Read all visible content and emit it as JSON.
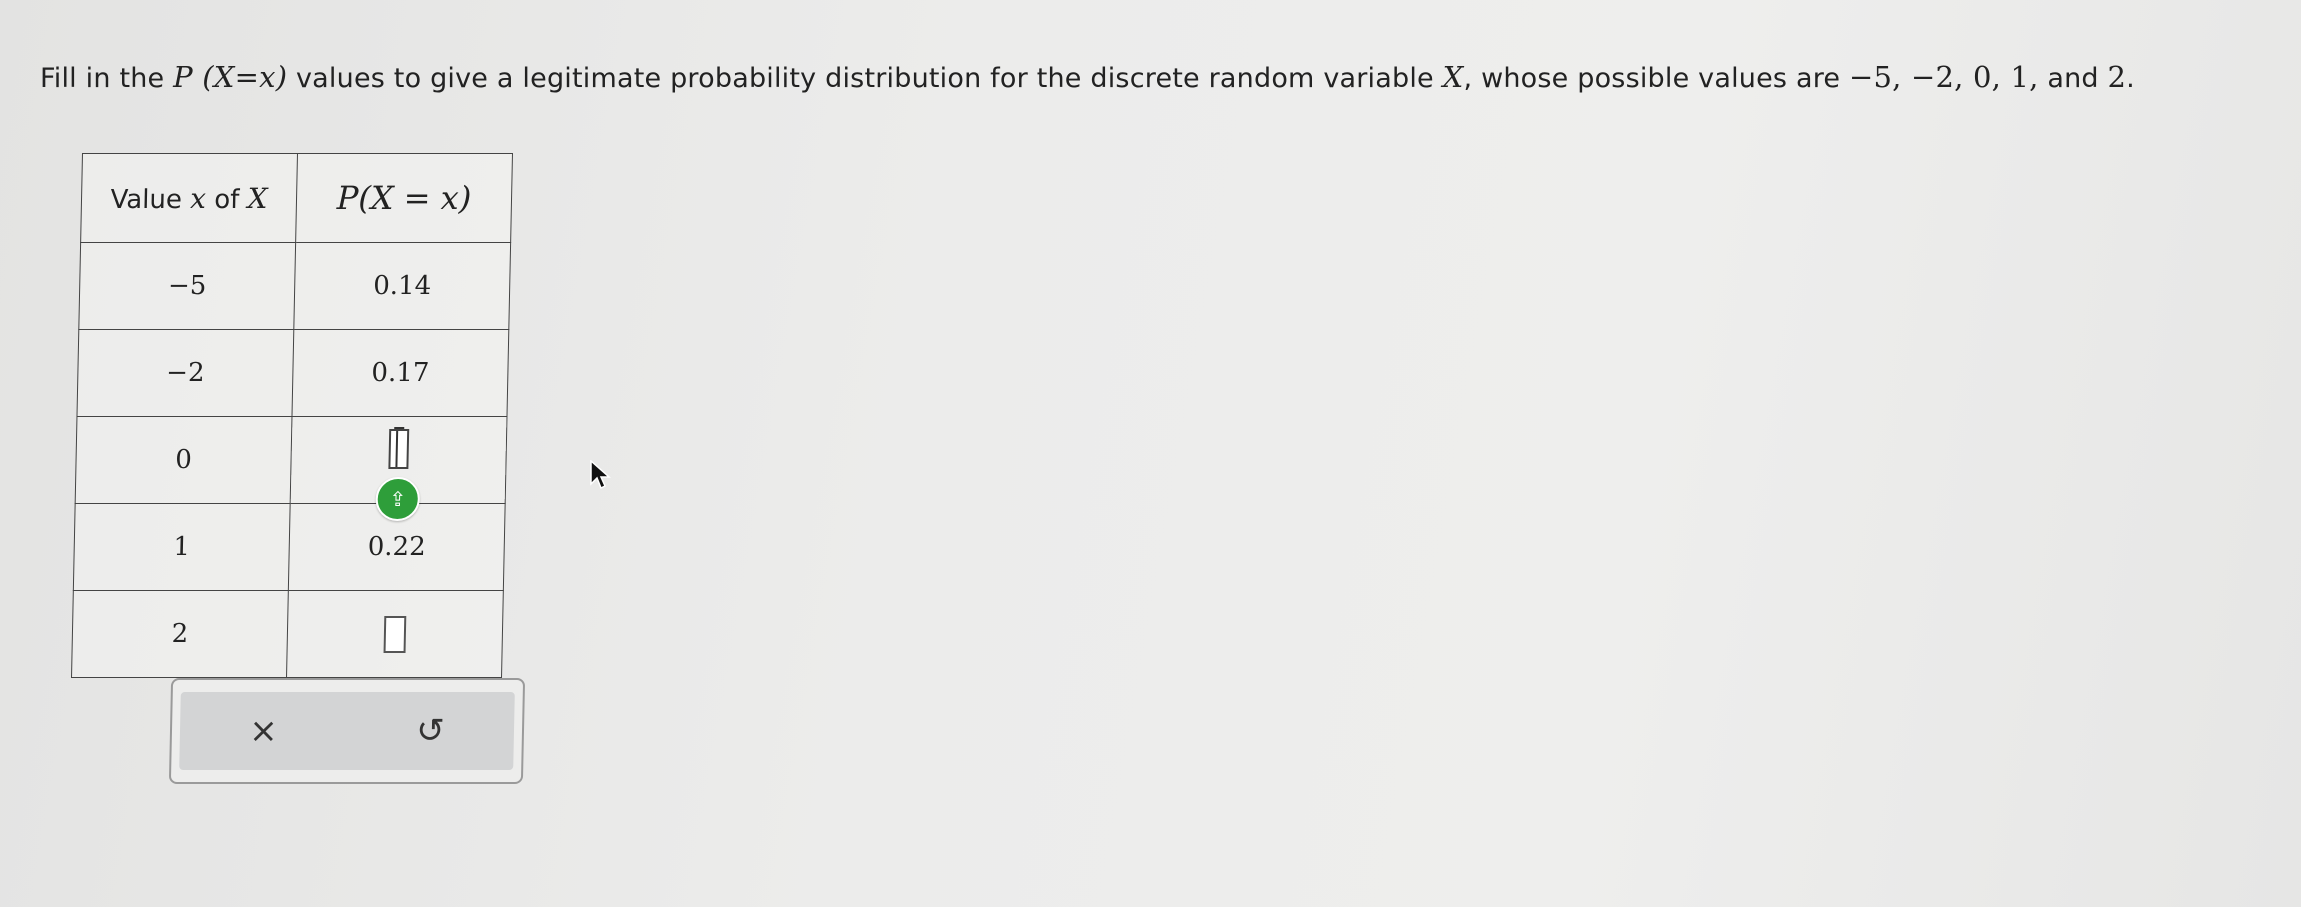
{
  "question": {
    "part1": "Fill in the ",
    "p_expr": "P (X=x)",
    "part2": " values to give a legitimate probability distribution for the discrete random variable ",
    "var": "X",
    "part3": ", whose possible values are ",
    "values_list": "−5, −2, 0, 1,",
    "part4": " and ",
    "last_value": "2",
    "part5": "."
  },
  "table": {
    "header_x_label": "Value ",
    "header_x_var": "x",
    "header_x_of": " of ",
    "header_x_X": "X",
    "header_p": "P(X = x)",
    "rows": [
      {
        "x": "−5",
        "p": "0.14"
      },
      {
        "x": "−2",
        "p": "0.17"
      },
      {
        "x": "0",
        "p": ""
      },
      {
        "x": "1",
        "p": "0.22"
      },
      {
        "x": "2",
        "p": ""
      }
    ]
  },
  "colors": {
    "keyboard_badge": "#2e9e3a",
    "panel_bg": "#d3d4d5"
  },
  "icons": {
    "clear": "x-icon",
    "reset": "undo-icon",
    "keyboard": "keyboard-toggle-icon"
  },
  "toolbar": {
    "clear_symbol": "×",
    "reset_symbol": "↺"
  }
}
